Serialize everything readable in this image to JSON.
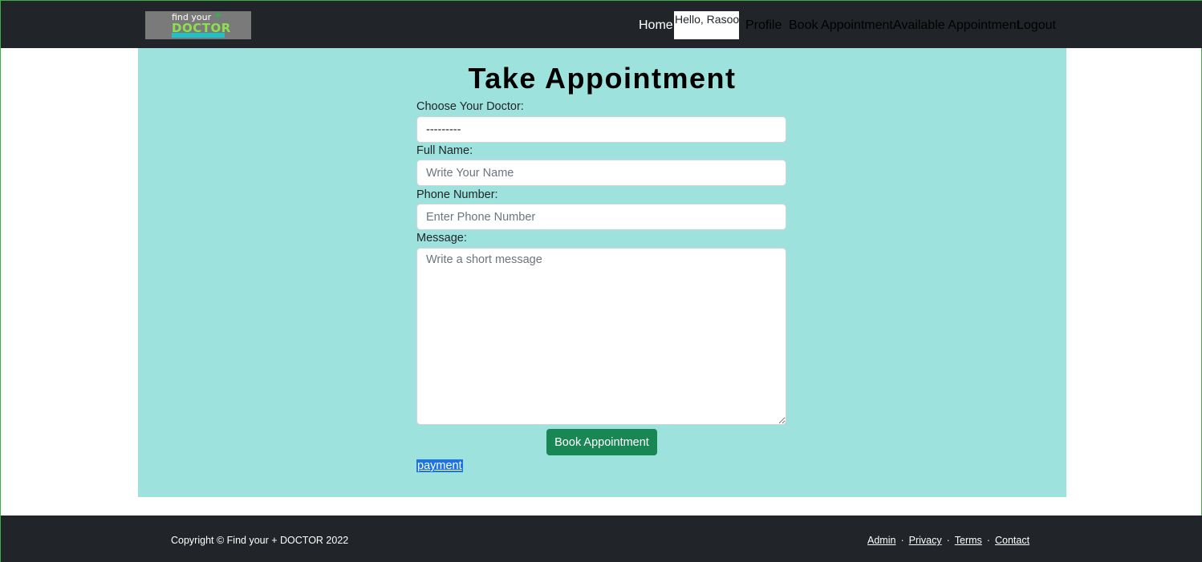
{
  "navbar": {
    "logo": {
      "line1": "find your",
      "plus": "+",
      "line2": "DOCTOR"
    },
    "home": "Home",
    "hello": "Hello, Rasool",
    "profile": "Profile",
    "book": "Book Appointment",
    "available": "Available Appointment",
    "logout": "Logout"
  },
  "main": {
    "title": "Take Appointment",
    "doctor_label": "Choose Your Doctor:",
    "doctor_selected": "---------",
    "name_label": "Full Name:",
    "name_placeholder": "Write Your Name",
    "phone_label": "Phone Number:",
    "phone_placeholder": "Enter Phone Number",
    "message_label": "Message:",
    "message_placeholder": "Write a short message",
    "submit": "Book Appointment",
    "payment": "payment"
  },
  "footer": {
    "copyright": "Copyright © Find your + DOCTOR 2022",
    "links": [
      "Admin",
      "Privacy",
      "Terms",
      "Contact"
    ],
    "separator": "·"
  },
  "colors": {
    "navbar_bg": "#212529",
    "main_bg": "#9de2dc",
    "button_bg": "#198754",
    "link_highlight": "#1a73e8"
  }
}
